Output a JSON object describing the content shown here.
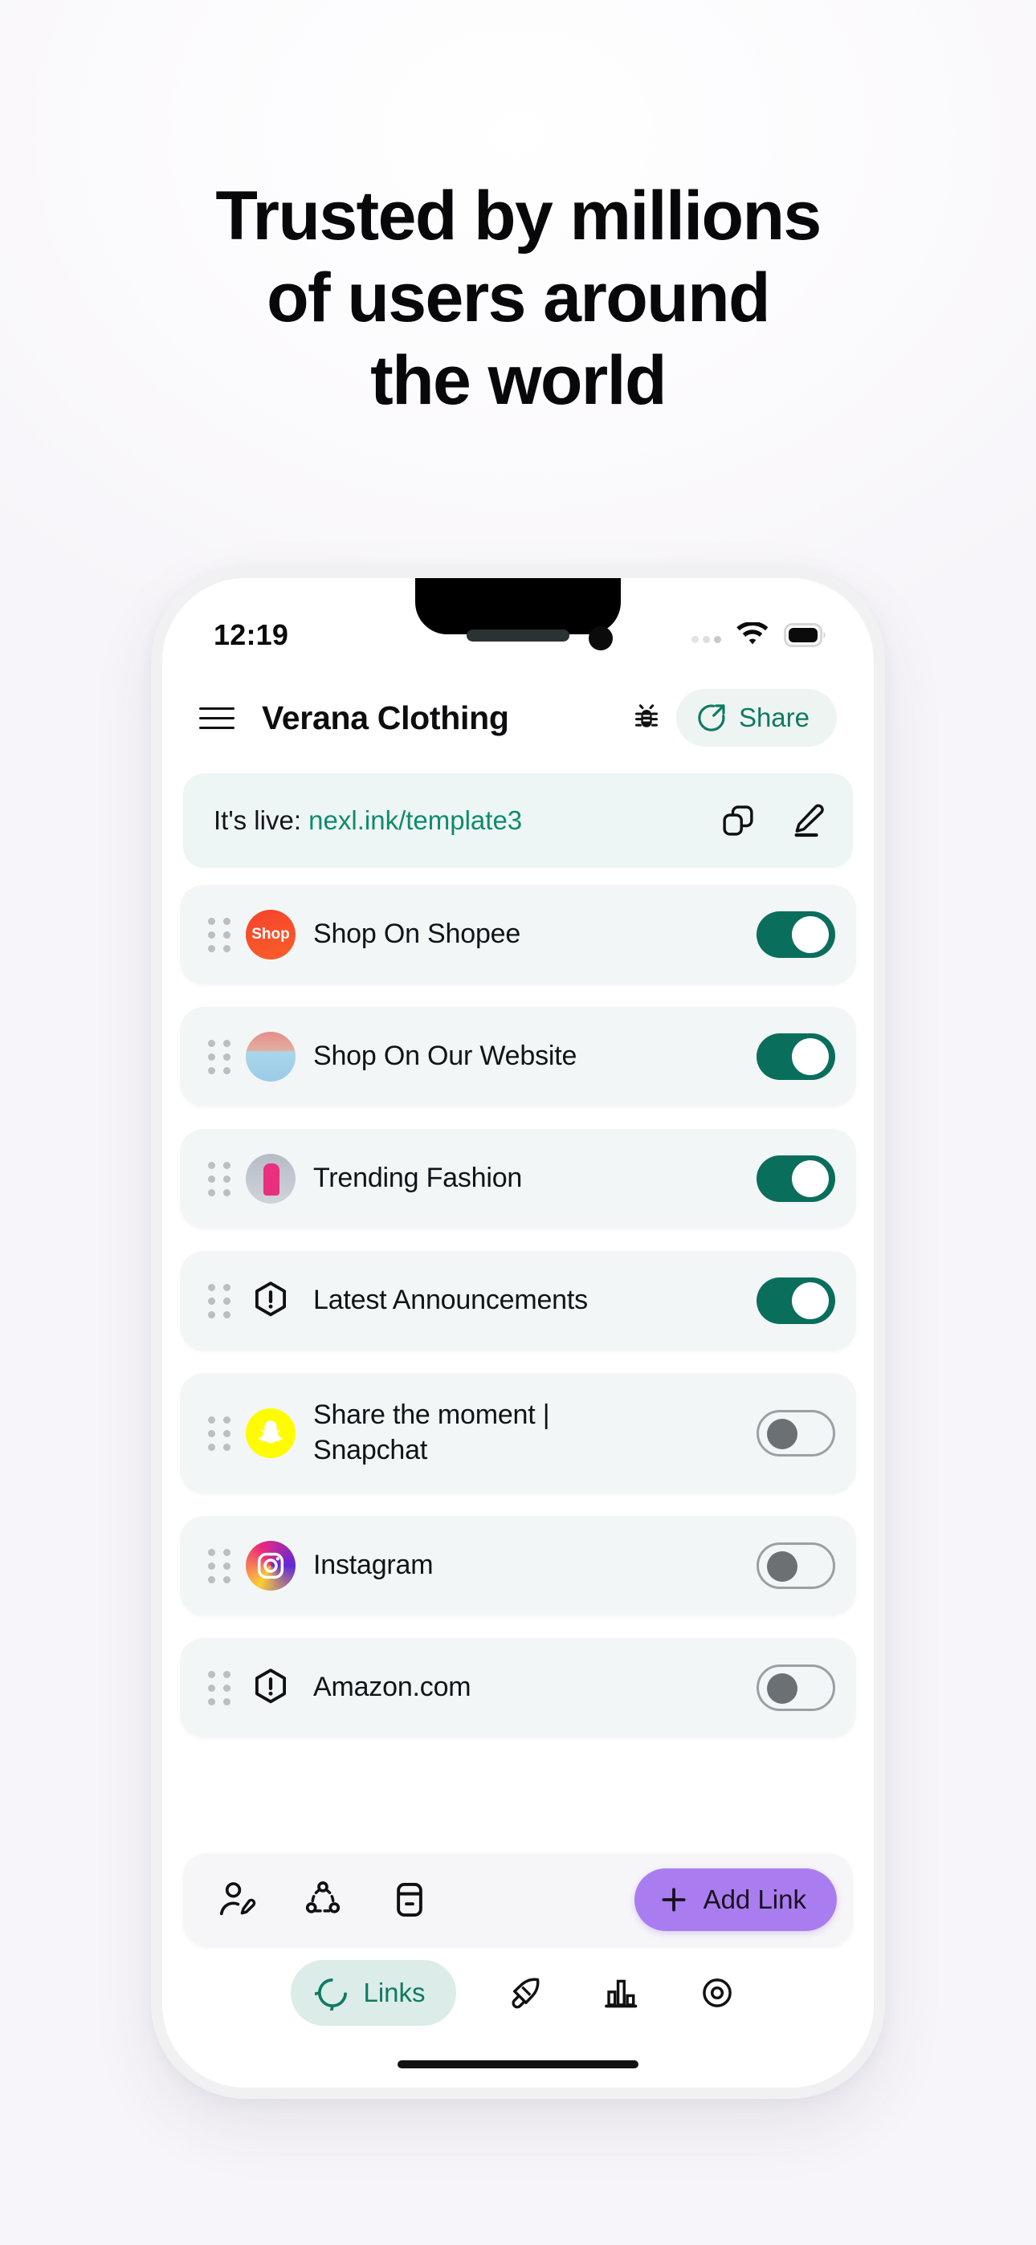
{
  "page": {
    "headline_lines": [
      "Trusted by millions",
      "of users around",
      "the world"
    ]
  },
  "phone": {
    "status_bar": {
      "time": "12:19",
      "wifi_icon": "wifi-icon",
      "battery_icon": "battery-full-icon",
      "signal_icon": "signal-dots-icon"
    },
    "header": {
      "menu_icon": "hamburger-menu-icon",
      "title": "Verana Clothing",
      "bug_icon": "bug-icon",
      "share_label": "Share",
      "share_icon": "share-arrow-icon"
    },
    "live_banner": {
      "prefix": "It's live: ",
      "url": "nexl.ink/template3",
      "copy_icon": "copy-icon",
      "edit_icon": "pencil-edit-icon"
    },
    "links": [
      {
        "label": "Shop On Shopee",
        "icon": "shopee-logo-icon",
        "avatar_text": "Shop",
        "enabled": true,
        "toggle_state": "on"
      },
      {
        "label": "Shop On Our Website",
        "icon": "website-thumbnail-icon",
        "avatar_text": "",
        "enabled": true,
        "toggle_state": "on"
      },
      {
        "label": "Trending Fashion",
        "icon": "fashion-thumbnail-icon",
        "avatar_text": "",
        "enabled": true,
        "toggle_state": "on"
      },
      {
        "label": "Latest Announcements",
        "icon": "alert-hexagon-icon",
        "avatar_text": "",
        "enabled": true,
        "toggle_state": "on"
      },
      {
        "label": "Share the moment | Snapchat",
        "icon": "snapchat-logo-icon",
        "avatar_text": "",
        "enabled": false,
        "toggle_state": "off"
      },
      {
        "label": "Instagram",
        "icon": "instagram-logo-icon",
        "avatar_text": "",
        "enabled": false,
        "toggle_state": "off"
      },
      {
        "label": "Amazon.com",
        "icon": "alert-hexagon-icon",
        "avatar_text": "",
        "enabled": false,
        "toggle_state": "off"
      }
    ],
    "action_bar": {
      "profile_edit_icon": "user-edit-icon",
      "share_circle_icon": "share-nodes-icon",
      "archive_icon": "archive-box-icon",
      "add_link_label": "Add Link",
      "add_link_plus_icon": "plus-icon"
    },
    "tab_bar": {
      "tabs": [
        {
          "label": "Links",
          "icon": "links-chain-icon",
          "active": true
        },
        {
          "label": "",
          "icon": "rocket-icon",
          "active": false
        },
        {
          "label": "",
          "icon": "bar-chart-icon",
          "active": false
        },
        {
          "label": "",
          "icon": "target-eye-icon",
          "active": false
        }
      ]
    }
  },
  "colors": {
    "brand_green": "#0f7a63",
    "toggle_on": "#0a6e5c",
    "accent_purple": "#a97df0",
    "row_bg": "#f2f6f6",
    "banner_bg": "#eef5f5",
    "pink_sliver": "#fcc9ca"
  }
}
